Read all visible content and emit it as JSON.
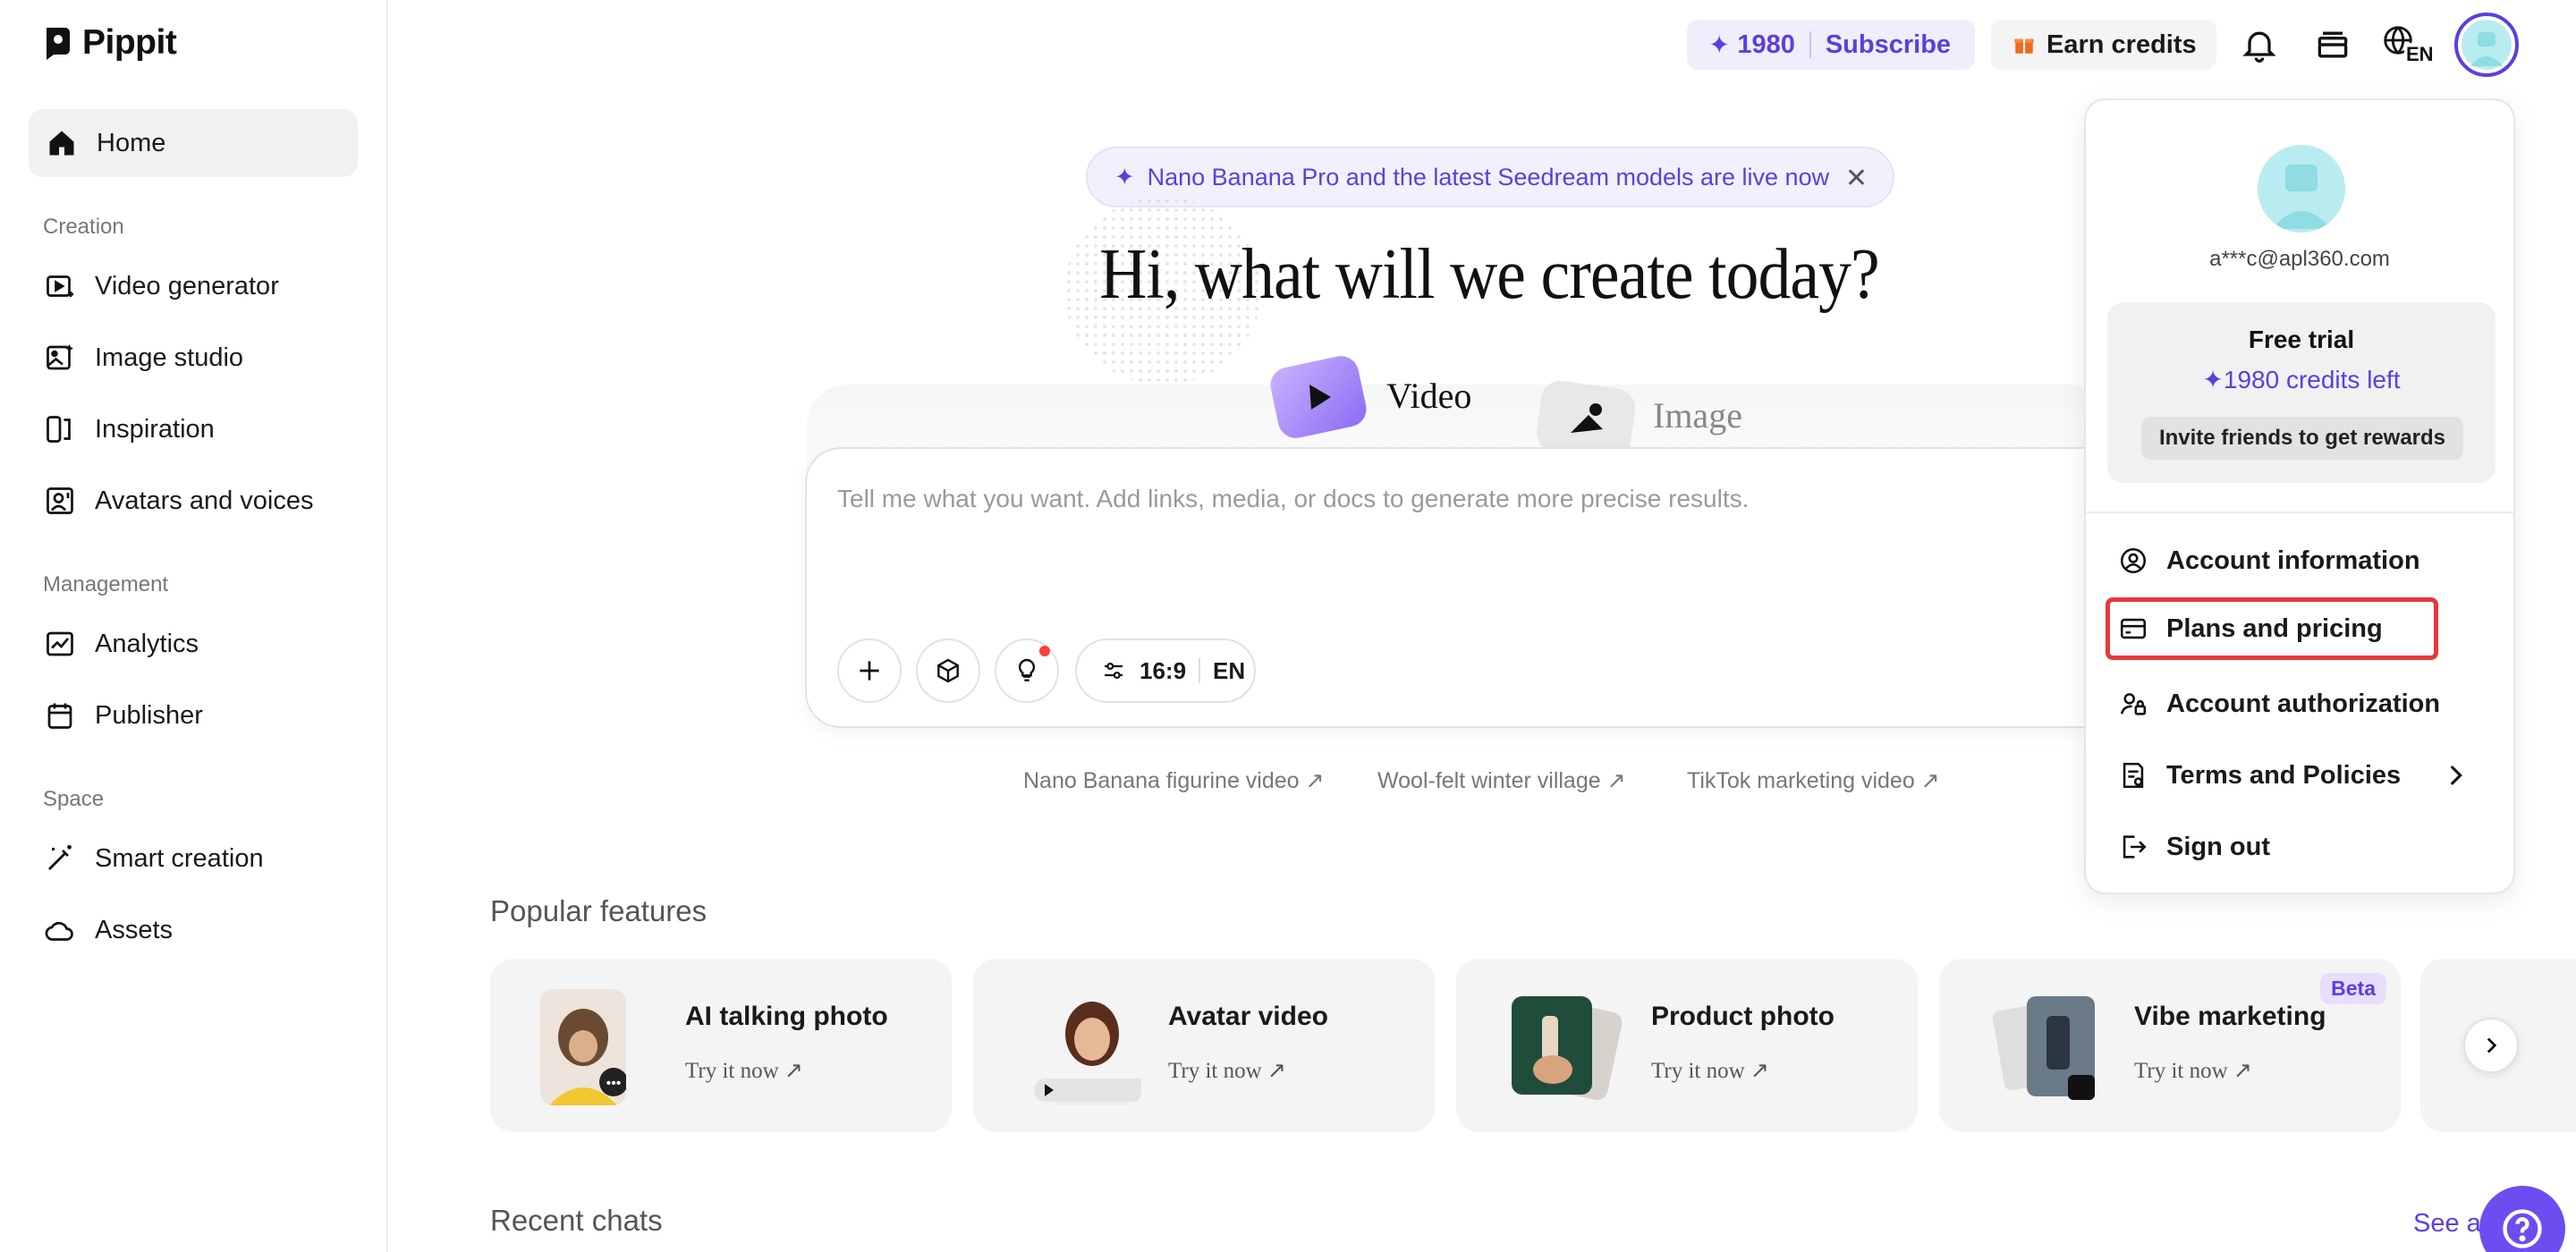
{
  "app": {
    "name": "Pippit"
  },
  "sidebar": {
    "home": "Home",
    "sections": [
      {
        "title": "Creation",
        "items": [
          "Video generator",
          "Image studio",
          "Inspiration",
          "Avatars and voices"
        ]
      },
      {
        "title": "Management",
        "items": [
          "Analytics",
          "Publisher"
        ]
      },
      {
        "title": "Space",
        "items": [
          "Smart creation",
          "Assets"
        ]
      }
    ]
  },
  "topbar": {
    "credits": "1980",
    "subscribe": "Subscribe",
    "earn_credits": "Earn credits",
    "language": "EN",
    "icons": [
      "bell-icon",
      "stack-icon",
      "globe-icon"
    ]
  },
  "main": {
    "banner": "Nano Banana Pro and the latest Seedream models are live now",
    "hero": "Hi, what will we create today?",
    "modes": [
      "Video",
      "Image"
    ],
    "composer": {
      "placeholder": "Tell me what you want. Add links, media, or docs to generate more precise results.",
      "ratio": "16:9",
      "language": "EN"
    },
    "suggestions": [
      "Nano Banana figurine video ↗",
      "Wool-felt winter village ↗",
      "TikTok marketing video ↗"
    ],
    "popular_title": "Popular features",
    "features": [
      {
        "title": "AI talking photo",
        "cta": "Try it now ↗"
      },
      {
        "title": "Avatar video",
        "cta": "Try it now ↗"
      },
      {
        "title": "Product photo",
        "cta": "Try it now ↗"
      },
      {
        "title": "Vibe marketing",
        "cta": "Try it now ↗",
        "badge": "Beta"
      }
    ],
    "recent_title": "Recent chats",
    "see_all": "See all"
  },
  "account_menu": {
    "email": "a***c@apl360.com",
    "plan": "Free trial",
    "credits_left": "1980 credits left",
    "invite": "Invite friends to get rewards",
    "items": [
      "Account information",
      "Plans and pricing",
      "Account authorization",
      "Terms and Policies",
      "Sign out"
    ]
  },
  "colors": {
    "accent": "#5b3fe0",
    "highlight_border": "#e8373c",
    "help_button": "#6c4ef0"
  }
}
